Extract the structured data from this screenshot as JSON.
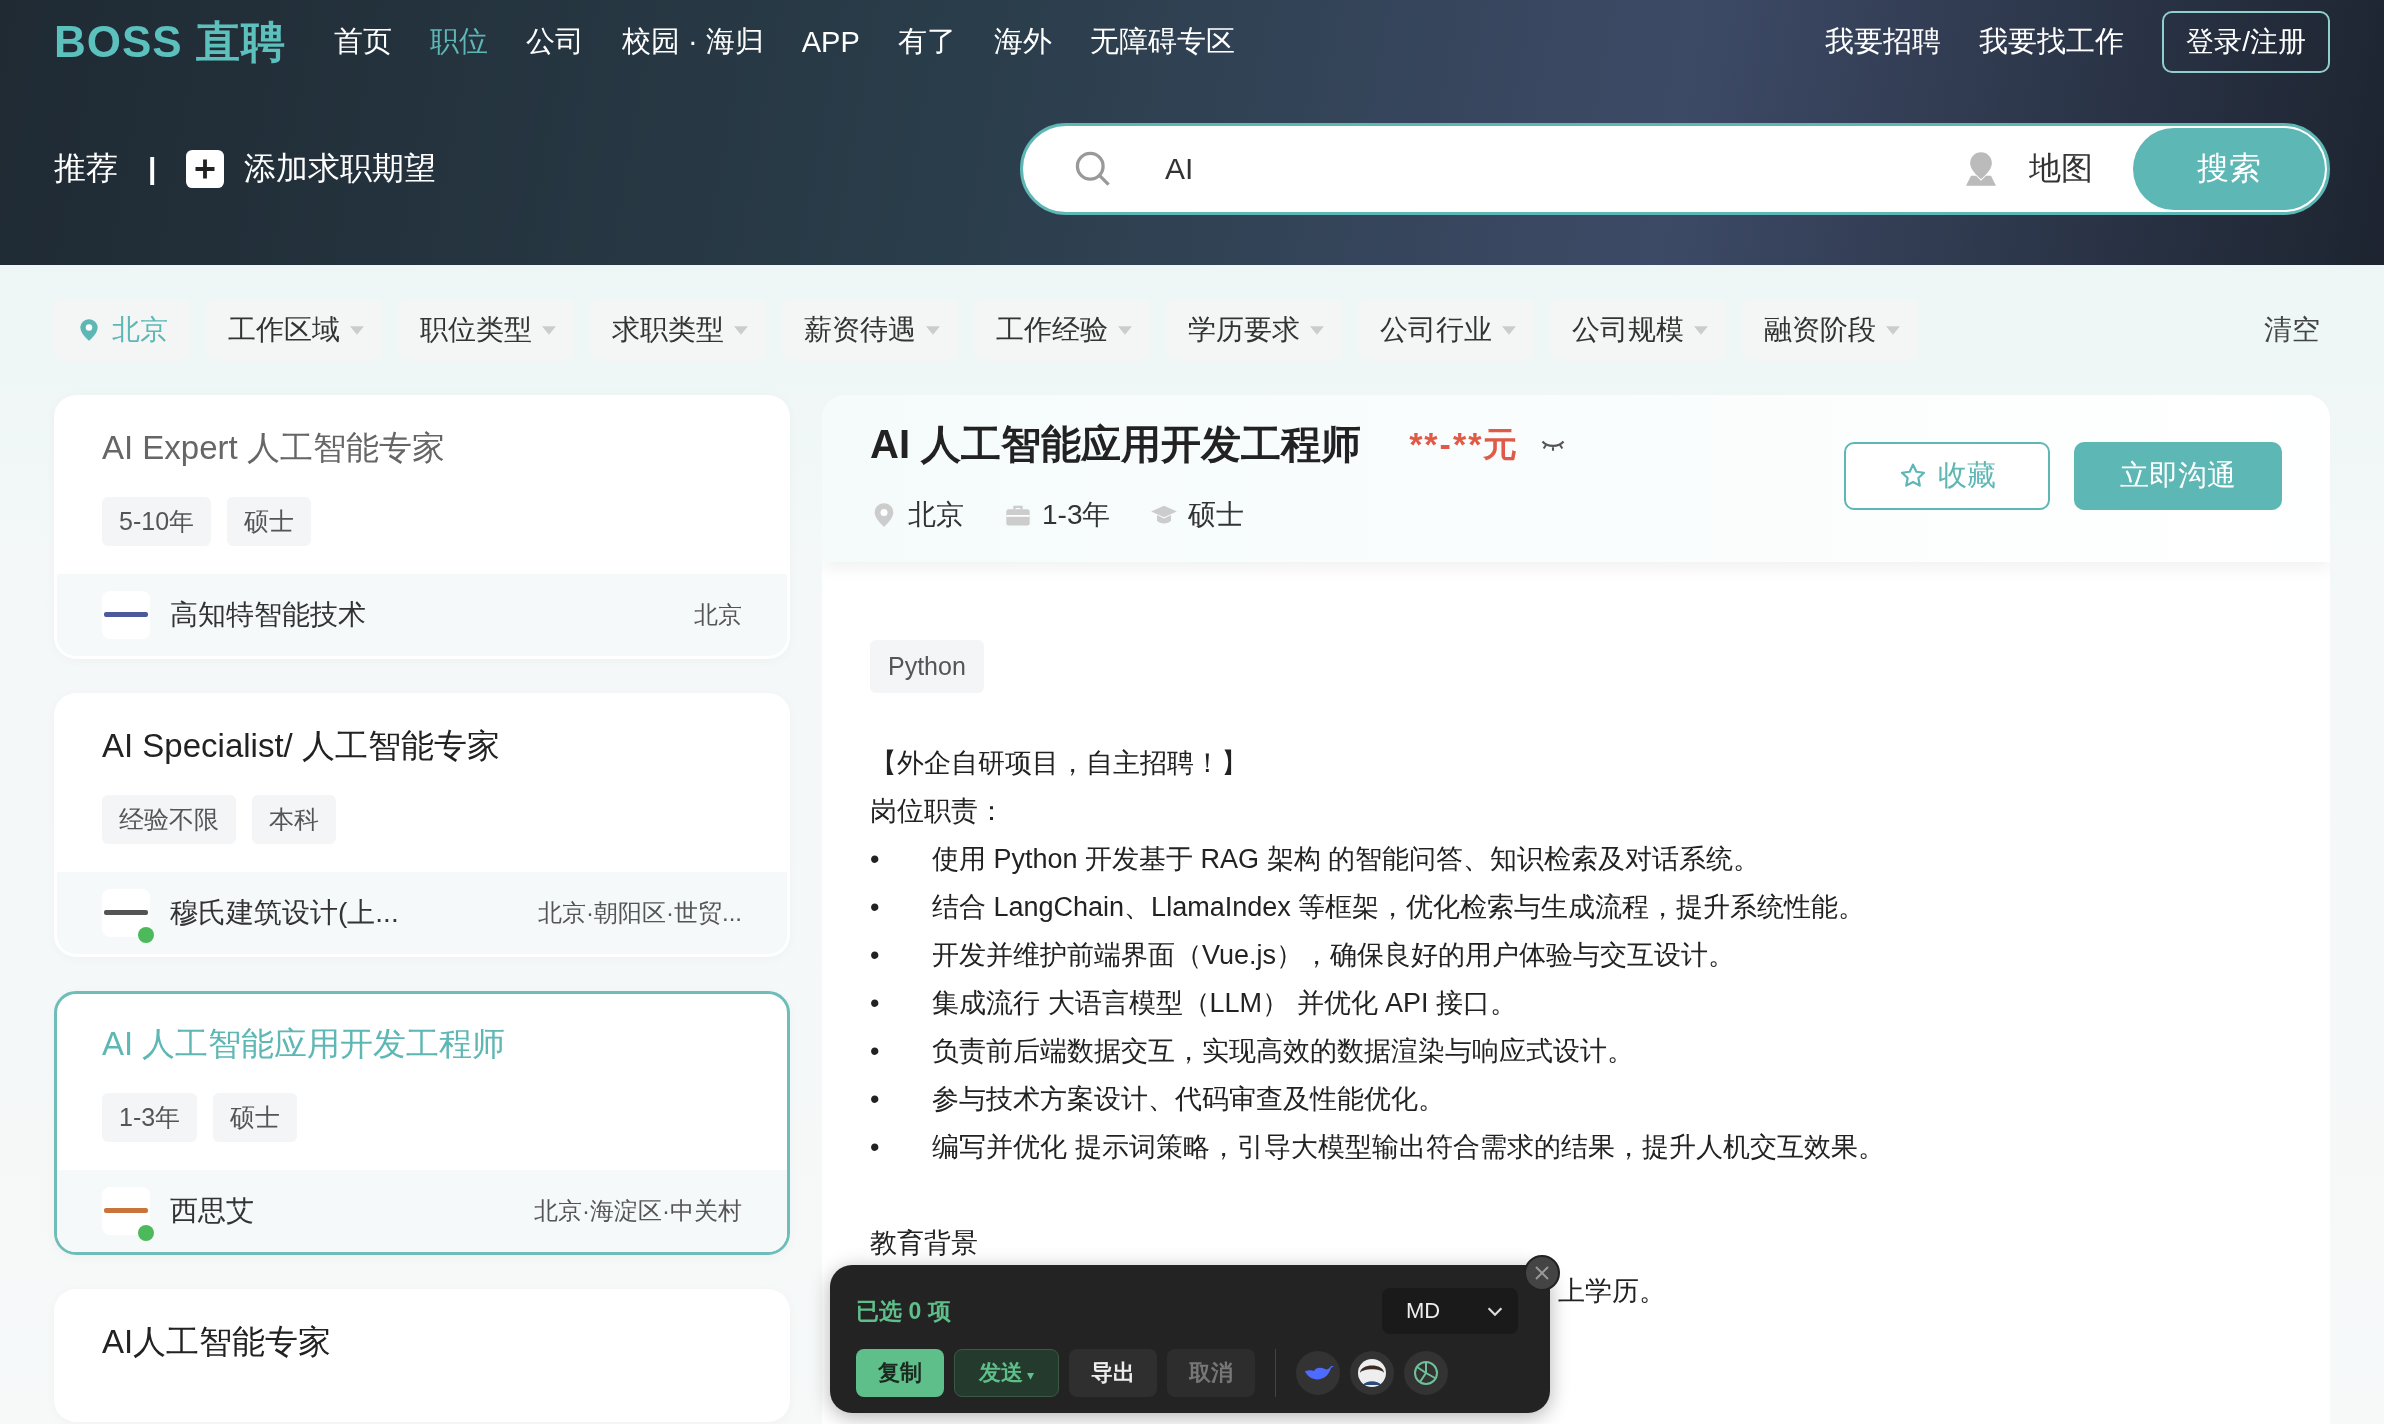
{
  "brand": {
    "logo": "BOSS 直聘"
  },
  "nav": [
    {
      "label": "首页",
      "selected": false
    },
    {
      "label": "职位",
      "selected": true
    },
    {
      "label": "公司",
      "selected": false
    },
    {
      "label": "校园 · 海归",
      "selected": false
    },
    {
      "label": "APP",
      "selected": false
    },
    {
      "label": "有了",
      "selected": false
    },
    {
      "label": "海外",
      "selected": false
    },
    {
      "label": "无障碍专区",
      "selected": false
    }
  ],
  "header_links": [
    "我要招聘",
    "我要找工作"
  ],
  "login_button": "登录/注册",
  "subnav": {
    "recommend": "推荐",
    "separator": "|",
    "add_expectation": "添加求职期望"
  },
  "search": {
    "value": "AI",
    "map_label": "地图",
    "button": "搜索"
  },
  "filters": {
    "city": "北京",
    "dropdowns": [
      "工作区域",
      "职位类型",
      "求职类型",
      "薪资待遇",
      "工作经验",
      "学历要求",
      "公司行业",
      "公司规模",
      "融资阶段"
    ],
    "clear": "清空"
  },
  "job_list": [
    {
      "title": "AI Expert 人工智能专家",
      "tags": [
        "5-10年",
        "硕士"
      ],
      "company": "高知特智能技术",
      "location": "北京",
      "selected": false,
      "visited": true,
      "online": false
    },
    {
      "title": "AI Specialist/ 人工智能专家",
      "tags": [
        "经验不限",
        "本科"
      ],
      "company": "穆氏建筑设计(上...",
      "location": "北京·朝阳区·世贸...",
      "selected": false,
      "visited": false,
      "online": true
    },
    {
      "title": "AI 人工智能应用开发工程师",
      "tags": [
        "1-3年",
        "硕士"
      ],
      "company": "西思艾",
      "location": "北京·海淀区·中关村",
      "selected": true,
      "visited": false,
      "online": true
    },
    {
      "title": "AI人工智能专家",
      "selected": false,
      "visited": false
    }
  ],
  "detail": {
    "title": "AI 人工智能应用开发工程师",
    "salary": "**-**元",
    "location": "北京",
    "experience": "1-3年",
    "education": "硕士",
    "favorite_button": "收藏",
    "chat_button": "立即沟通",
    "skill_tags": [
      "Python"
    ],
    "description": [
      {
        "kind": "text",
        "text": "【外企自研项目，自主招聘！】"
      },
      {
        "kind": "text",
        "text": "岗位职责："
      },
      {
        "kind": "bullet",
        "marker": "•",
        "text": "使用 Python 开发基于 RAG 架构 的智能问答、知识检索及对话系统。"
      },
      {
        "kind": "bullet",
        "marker": "•",
        "text": "结合 LangChain、LlamaIndex 等框架，优化检索与生成流程，提升系统性能。"
      },
      {
        "kind": "bullet",
        "marker": "•",
        "text": "开发并维护前端界面（Vue.js），确保良好的用户体验与交互设计。"
      },
      {
        "kind": "bullet",
        "marker": "•",
        "text": "集成流行 大语言模型（LLM） 并优化 API 接口。"
      },
      {
        "kind": "bullet",
        "marker": "•",
        "text": "负责前后端数据交互，实现高效的数据渲染与响应式设计。"
      },
      {
        "kind": "bullet",
        "marker": "•",
        "text": "参与技术方案设计、代码审查及性能优化。"
      },
      {
        "kind": "bullet",
        "marker": "•",
        "text": "编写并优化 提示词策略，引导大模型输出符合需求的结果，提升人机交互效果。"
      },
      {
        "kind": "heading",
        "text": "教育背景"
      },
      {
        "kind": "covered",
        "text": "上学历。"
      }
    ]
  },
  "toolbar": {
    "selected_count": "已选 0 项",
    "format": "MD",
    "buttons": [
      {
        "label": "复制",
        "kind": "primary"
      },
      {
        "label": "发送",
        "kind": "dropdown",
        "caret": "▾"
      },
      {
        "label": "导出",
        "kind": "plain"
      },
      {
        "label": "取消",
        "kind": "disabled"
      }
    ]
  }
}
